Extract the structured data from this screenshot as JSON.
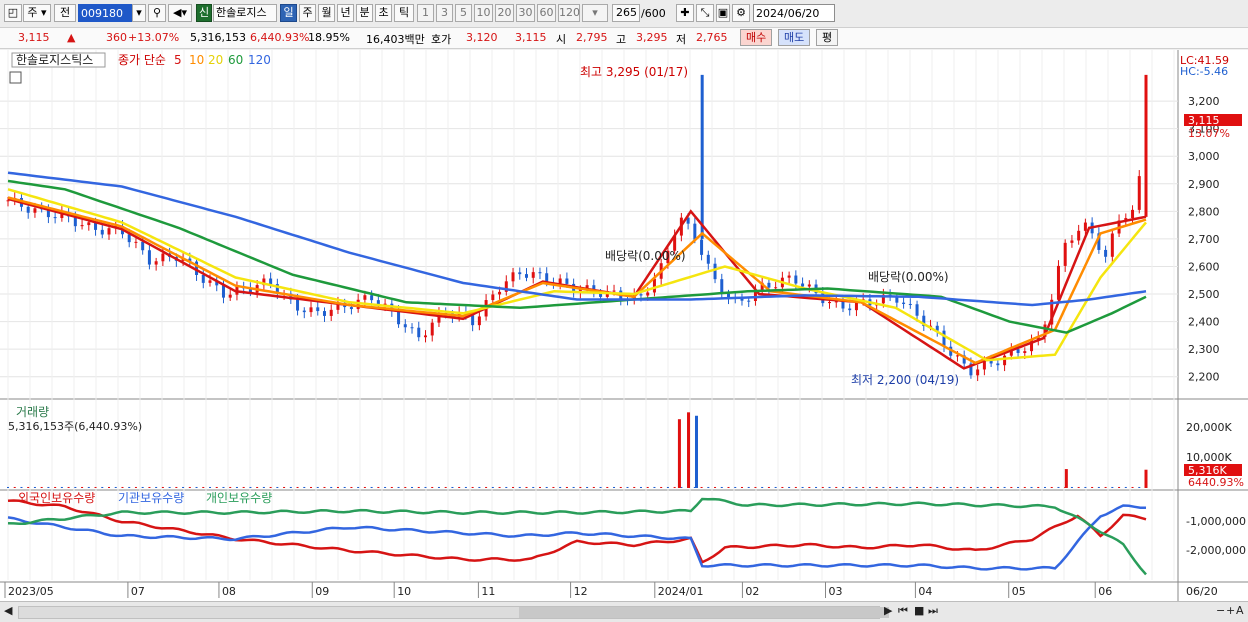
{
  "toolbar": {
    "period_select": "주",
    "prev_label": "전",
    "stock_code": "009180",
    "badge": "신",
    "stock_name": "한솔로지스",
    "periods": [
      "일",
      "주",
      "월",
      "년",
      "분",
      "초",
      "틱"
    ],
    "intervals": [
      "1",
      "3",
      "5",
      "10",
      "20",
      "30",
      "60",
      "120"
    ],
    "count": "265",
    "count_total": "/600",
    "date": "2024/06/20"
  },
  "quote": {
    "price": "3,115",
    "change_arrow": "▲",
    "change": "360",
    "change_pct": "+13.07%",
    "volume": "5,316,153",
    "volume_pct": "6,440.93%",
    "turnover": "18.95%",
    "amount": "16,403백만",
    "bid_label": "호가",
    "bid": "3,120",
    "ask": "3,115",
    "open_label": "시",
    "open": "2,795",
    "high_label": "고",
    "high": "3,295",
    "low_label": "저",
    "low": "2,765",
    "buy_label": "매수",
    "sell_label": "매도",
    "avg_label": "평"
  },
  "legend": {
    "name": "한솔로지스틱스",
    "ma_label": "종가 단순",
    "ma_periods": [
      "5",
      "10",
      "20",
      "60",
      "120"
    ],
    "volume_title": "거래량",
    "volume_value": "5,316,153주(6,440.93%)",
    "holdings": [
      "외국인보유수량",
      "기관보유수량",
      "개인보유수량"
    ]
  },
  "axis": {
    "lc": "LC:41.59",
    "hc": "HC:-5.46",
    "price_ticks": [
      "3,200",
      "3,100",
      "3,000",
      "2,900",
      "2,800",
      "2,700",
      "2,600",
      "2,500",
      "2,400",
      "2,300",
      "2,200"
    ],
    "last_price": "3,115",
    "last_pct": "13.07%",
    "vol_ticks": [
      "20,000K",
      "10,000K"
    ],
    "vol_last": "5,316K",
    "vol_last_pct": "6440.93%",
    "hold_ticks": [
      "-1,000,000",
      "-2,000,000"
    ],
    "dates": [
      "2023/05",
      "07",
      "08",
      "09",
      "10",
      "11",
      "12",
      "2024/01",
      "02",
      "03",
      "04",
      "05",
      "06",
      "06/20"
    ]
  },
  "annotations": {
    "high": "최고 3,295 (01/17)",
    "low": "최저 2,200 (04/19)",
    "div1": "배당락(0.00%)",
    "div2": "배당락(0.00%)"
  },
  "colors": {
    "up": "#e01010",
    "down": "#1e5fd0",
    "ma5": "#d61414",
    "ma10": "#ff8c00",
    "ma20": "#f5e50f",
    "ma60": "#1e9a3c",
    "ma120": "#3366e0",
    "foreign": "#d61414",
    "inst": "#3366e0",
    "indiv": "#2a9d5a"
  },
  "chart_data": {
    "type": "line",
    "title": "한솔로지스틱스",
    "price_range": [
      2130,
      3320
    ],
    "anchors": [
      [
        0.0,
        2840
      ],
      [
        0.025,
        2800
      ],
      [
        0.05,
        2780
      ],
      [
        0.075,
        2735
      ],
      [
        0.1,
        2730
      ],
      [
        0.125,
        2620
      ],
      [
        0.15,
        2640
      ],
      [
        0.17,
        2560
      ],
      [
        0.19,
        2500
      ],
      [
        0.21,
        2520
      ],
      [
        0.23,
        2545
      ],
      [
        0.25,
        2460
      ],
      [
        0.27,
        2430
      ],
      [
        0.3,
        2460
      ],
      [
        0.32,
        2490
      ],
      [
        0.34,
        2420
      ],
      [
        0.36,
        2340
      ],
      [
        0.385,
        2440
      ],
      [
        0.41,
        2400
      ],
      [
        0.43,
        2520
      ],
      [
        0.45,
        2580
      ],
      [
        0.47,
        2560
      ],
      [
        0.5,
        2520
      ],
      [
        0.53,
        2500
      ],
      [
        0.555,
        2480
      ],
      [
        0.575,
        2600
      ],
      [
        0.59,
        2780
      ],
      [
        0.605,
        2700
      ],
      [
        0.62,
        2550
      ],
      [
        0.64,
        2460
      ],
      [
        0.66,
        2520
      ],
      [
        0.69,
        2560
      ],
      [
        0.71,
        2500
      ],
      [
        0.73,
        2450
      ],
      [
        0.755,
        2470
      ],
      [
        0.78,
        2490
      ],
      [
        0.8,
        2420
      ],
      [
        0.815,
        2360
      ],
      [
        0.83,
        2280
      ],
      [
        0.845,
        2220
      ],
      [
        0.865,
        2250
      ],
      [
        0.885,
        2290
      ],
      [
        0.905,
        2330
      ],
      [
        0.915,
        2450
      ],
      [
        0.93,
        2700
      ],
      [
        0.95,
        2750
      ],
      [
        0.965,
        2620
      ],
      [
        0.975,
        2780
      ],
      [
        0.99,
        2790
      ],
      [
        1.0,
        3115
      ]
    ],
    "moving_averages": [
      {
        "name": "5",
        "anchors": [
          [
            0,
            2845
          ],
          [
            0.1,
            2735
          ],
          [
            0.2,
            2510
          ],
          [
            0.3,
            2460
          ],
          [
            0.4,
            2410
          ],
          [
            0.47,
            2545
          ],
          [
            0.55,
            2490
          ],
          [
            0.6,
            2800
          ],
          [
            0.66,
            2500
          ],
          [
            0.75,
            2470
          ],
          [
            0.84,
            2230
          ],
          [
            0.91,
            2340
          ],
          [
            0.95,
            2740
          ],
          [
            1,
            2780
          ]
        ]
      },
      {
        "name": "10",
        "anchors": [
          [
            0,
            2850
          ],
          [
            0.1,
            2745
          ],
          [
            0.2,
            2530
          ],
          [
            0.3,
            2460
          ],
          [
            0.4,
            2420
          ],
          [
            0.47,
            2540
          ],
          [
            0.55,
            2490
          ],
          [
            0.61,
            2720
          ],
          [
            0.67,
            2510
          ],
          [
            0.75,
            2470
          ],
          [
            0.85,
            2250
          ],
          [
            0.92,
            2370
          ],
          [
            0.96,
            2720
          ],
          [
            1,
            2770
          ]
        ]
      },
      {
        "name": "20",
        "anchors": [
          [
            0,
            2880
          ],
          [
            0.1,
            2760
          ],
          [
            0.2,
            2560
          ],
          [
            0.3,
            2470
          ],
          [
            0.4,
            2430
          ],
          [
            0.48,
            2510
          ],
          [
            0.55,
            2500
          ],
          [
            0.63,
            2600
          ],
          [
            0.7,
            2520
          ],
          [
            0.78,
            2450
          ],
          [
            0.86,
            2260
          ],
          [
            0.92,
            2280
          ],
          [
            0.96,
            2560
          ],
          [
            1,
            2760
          ]
        ]
      },
      {
        "name": "60",
        "anchors": [
          [
            0,
            2910
          ],
          [
            0.05,
            2880
          ],
          [
            0.15,
            2740
          ],
          [
            0.25,
            2570
          ],
          [
            0.35,
            2470
          ],
          [
            0.45,
            2450
          ],
          [
            0.55,
            2480
          ],
          [
            0.65,
            2510
          ],
          [
            0.72,
            2520
          ],
          [
            0.82,
            2490
          ],
          [
            0.88,
            2400
          ],
          [
            0.93,
            2360
          ],
          [
            0.97,
            2430
          ],
          [
            1,
            2490
          ]
        ]
      },
      {
        "name": "120",
        "anchors": [
          [
            0,
            2940
          ],
          [
            0.1,
            2890
          ],
          [
            0.2,
            2780
          ],
          [
            0.3,
            2650
          ],
          [
            0.4,
            2540
          ],
          [
            0.5,
            2480
          ],
          [
            0.6,
            2480
          ],
          [
            0.7,
            2495
          ],
          [
            0.8,
            2490
          ],
          [
            0.9,
            2460
          ],
          [
            0.95,
            2480
          ],
          [
            1,
            2510
          ]
        ]
      }
    ],
    "volume_spikes": [
      [
        0.59,
        20000
      ],
      [
        0.598,
        22000
      ],
      [
        0.605,
        21000
      ],
      [
        0.93,
        5500
      ],
      [
        1.0,
        5316
      ]
    ],
    "holdings": [
      {
        "name": "외국인보유수량",
        "anchors": [
          [
            0,
            -300000
          ],
          [
            0.05,
            -500000
          ],
          [
            0.1,
            -1000000
          ],
          [
            0.2,
            -1600000
          ],
          [
            0.3,
            -2000000
          ],
          [
            0.4,
            -2300000
          ],
          [
            0.46,
            -2300000
          ],
          [
            0.5,
            -1700000
          ],
          [
            0.55,
            -1800000
          ],
          [
            0.6,
            -1600000
          ],
          [
            0.61,
            -2400000
          ],
          [
            0.63,
            -1900000
          ],
          [
            0.7,
            -1800000
          ],
          [
            0.75,
            -1900000
          ],
          [
            0.8,
            -1800000
          ],
          [
            0.85,
            -2000000
          ],
          [
            0.9,
            -1600000
          ],
          [
            0.94,
            -800000
          ],
          [
            0.96,
            -1500000
          ],
          [
            0.98,
            -800000
          ],
          [
            1,
            -900000
          ]
        ]
      },
      {
        "name": "기관보유수량",
        "anchors": [
          [
            0,
            -900000
          ],
          [
            0.1,
            -1500000
          ],
          [
            0.2,
            -1600000
          ],
          [
            0.3,
            -1200000
          ],
          [
            0.4,
            -1400000
          ],
          [
            0.45,
            -1500000
          ],
          [
            0.5,
            -1400000
          ],
          [
            0.55,
            -1500000
          ],
          [
            0.6,
            -1600000
          ],
          [
            0.61,
            -2500000
          ],
          [
            0.7,
            -2500000
          ],
          [
            0.8,
            -2500000
          ],
          [
            0.85,
            -2600000
          ],
          [
            0.92,
            -2600000
          ],
          [
            0.96,
            -800000
          ],
          [
            0.98,
            -500000
          ],
          [
            1,
            -500000
          ]
        ]
      },
      {
        "name": "개인보유수량",
        "anchors": [
          [
            0,
            -1100000
          ],
          [
            0.05,
            -900000
          ],
          [
            0.1,
            -700000
          ],
          [
            0.2,
            -700000
          ],
          [
            0.3,
            -650000
          ],
          [
            0.4,
            -700000
          ],
          [
            0.5,
            -700000
          ],
          [
            0.6,
            -650000
          ],
          [
            0.61,
            -200000
          ],
          [
            0.65,
            -450000
          ],
          [
            0.8,
            -400000
          ],
          [
            0.92,
            -500000
          ],
          [
            0.95,
            -1100000
          ],
          [
            0.98,
            -1800000
          ],
          [
            1,
            -2800000
          ]
        ]
      }
    ]
  }
}
